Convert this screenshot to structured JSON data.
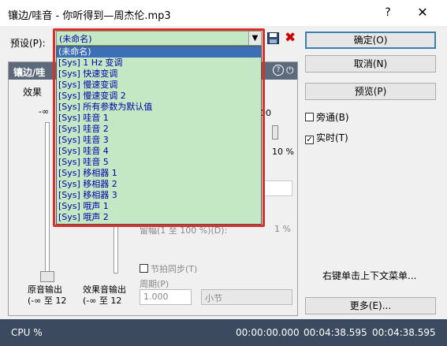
{
  "window": {
    "title": "镶边/哇音 - 你听得到—周杰伦.mp3",
    "help_label": "?",
    "close_label": "✕"
  },
  "preset": {
    "label": "预设(P):",
    "current_value": "(未命名)",
    "options": [
      "(未命名)",
      "[Sys] 1 Hz 变调",
      "[Sys] 快速变调",
      "[Sys] 慢速变调",
      "[Sys] 慢速变调 2",
      "[Sys] 所有参数为默认值",
      "[Sys] 哇音 1",
      "[Sys] 哇音 2",
      "[Sys] 哇音 3",
      "[Sys] 哇音 4",
      "[Sys] 哇音 5",
      "[Sys] 移相器 1",
      "[Sys] 移相器 2",
      "[Sys] 移相器 3",
      "[Sys] 哦声 1",
      "[Sys] 哦声 2"
    ]
  },
  "buttons": {
    "ok": "确定(O)",
    "cancel": "取消(N)",
    "preview": "预览(P)",
    "more": "更多(E)..."
  },
  "checks": {
    "bypass": "旁通(B)",
    "realtime": "实时(T)",
    "realtime_checked": "✓"
  },
  "context_hint": "右键单击上下文菜单...",
  "plugin": {
    "title": "镶边/哇",
    "help_icon_label": "?",
    "effect_tab": "效果",
    "neg_inf": "-∞",
    "dry_out_line1": "原音输出",
    "dry_out_line2": "(-∞ 至 12",
    "wet_out_line1": "效果音输出",
    "wet_out_line2": "(-∞ 至 12",
    "right_val_1": "00",
    "right_val_2": "10 %",
    "rate_label": "留幅(1 至 100 %)(D):",
    "rate_value": "1 %",
    "sync_label": "节拍同步(T)",
    "period_label": "周期(P)",
    "period_value": "1.000",
    "period_unit": "小节"
  },
  "status": {
    "cpu": "CPU %",
    "time_1": "00:00:00.000",
    "time_2": "00:04:38.595",
    "time_3": "00:04:38.595"
  }
}
